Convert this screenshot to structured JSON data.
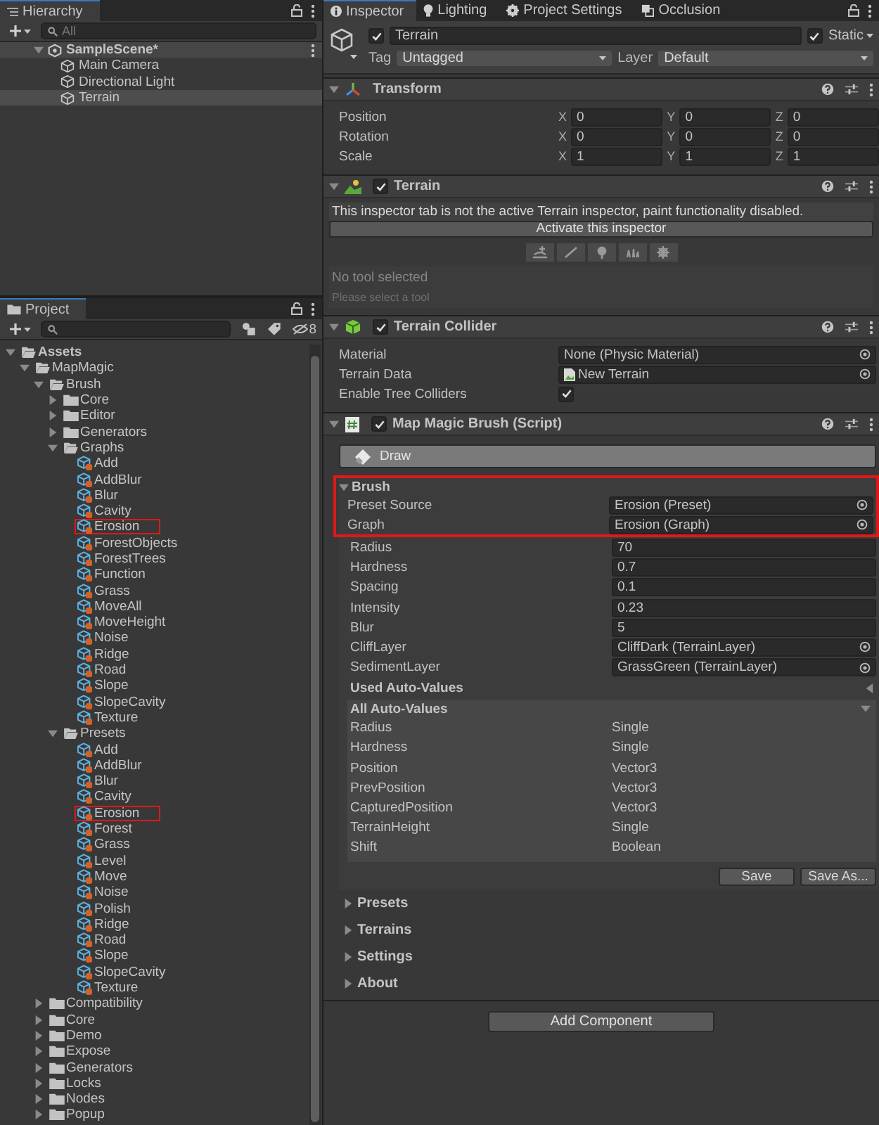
{
  "hierarchy": {
    "title": "Hierarchy",
    "search_placeholder": "All",
    "scene": {
      "name": "SampleScene*",
      "expanded": true,
      "children": [
        {
          "name": "Main Camera",
          "selected": false
        },
        {
          "name": "Directional Light",
          "selected": false
        },
        {
          "name": "Terrain",
          "selected": true
        }
      ]
    }
  },
  "project": {
    "title": "Project",
    "hidden_count": "8",
    "tree": [
      {
        "name": "Assets",
        "kind": "folder",
        "expanded": true,
        "children": [
          {
            "name": "MapMagic",
            "kind": "folder",
            "expanded": true,
            "children": [
              {
                "name": "Brush",
                "kind": "folder",
                "expanded": true,
                "children": [
                  {
                    "name": "Core",
                    "kind": "folder",
                    "expanded": false
                  },
                  {
                    "name": "Editor",
                    "kind": "folder",
                    "expanded": false
                  },
                  {
                    "name": "Generators",
                    "kind": "folder",
                    "expanded": false
                  },
                  {
                    "name": "Graphs",
                    "kind": "folder",
                    "expanded": true,
                    "children": [
                      {
                        "name": "Add",
                        "kind": "asset"
                      },
                      {
                        "name": "AddBlur",
                        "kind": "asset"
                      },
                      {
                        "name": "Blur",
                        "kind": "asset"
                      },
                      {
                        "name": "Cavity",
                        "kind": "asset"
                      },
                      {
                        "name": "Erosion",
                        "kind": "asset",
                        "annotated": true
                      },
                      {
                        "name": "ForestObjects",
                        "kind": "asset"
                      },
                      {
                        "name": "ForestTrees",
                        "kind": "asset"
                      },
                      {
                        "name": "Function",
                        "kind": "asset"
                      },
                      {
                        "name": "Grass",
                        "kind": "asset"
                      },
                      {
                        "name": "MoveAll",
                        "kind": "asset"
                      },
                      {
                        "name": "MoveHeight",
                        "kind": "asset"
                      },
                      {
                        "name": "Noise",
                        "kind": "asset"
                      },
                      {
                        "name": "Ridge",
                        "kind": "asset"
                      },
                      {
                        "name": "Road",
                        "kind": "asset"
                      },
                      {
                        "name": "Slope",
                        "kind": "asset"
                      },
                      {
                        "name": "SlopeCavity",
                        "kind": "asset"
                      },
                      {
                        "name": "Texture",
                        "kind": "asset"
                      }
                    ]
                  },
                  {
                    "name": "Presets",
                    "kind": "folder",
                    "expanded": true,
                    "children": [
                      {
                        "name": "Add",
                        "kind": "asset"
                      },
                      {
                        "name": "AddBlur",
                        "kind": "asset"
                      },
                      {
                        "name": "Blur",
                        "kind": "asset"
                      },
                      {
                        "name": "Cavity",
                        "kind": "asset"
                      },
                      {
                        "name": "Erosion",
                        "kind": "asset",
                        "annotated": true
                      },
                      {
                        "name": "Forest",
                        "kind": "asset"
                      },
                      {
                        "name": "Grass",
                        "kind": "asset"
                      },
                      {
                        "name": "Level",
                        "kind": "asset"
                      },
                      {
                        "name": "Move",
                        "kind": "asset"
                      },
                      {
                        "name": "Noise",
                        "kind": "asset"
                      },
                      {
                        "name": "Polish",
                        "kind": "asset"
                      },
                      {
                        "name": "Ridge",
                        "kind": "asset"
                      },
                      {
                        "name": "Road",
                        "kind": "asset"
                      },
                      {
                        "name": "Slope",
                        "kind": "asset"
                      },
                      {
                        "name": "SlopeCavity",
                        "kind": "asset"
                      },
                      {
                        "name": "Texture",
                        "kind": "asset"
                      }
                    ]
                  }
                ]
              },
              {
                "name": "Compatibility",
                "kind": "folder",
                "expanded": false
              },
              {
                "name": "Core",
                "kind": "folder",
                "expanded": false
              },
              {
                "name": "Demo",
                "kind": "folder",
                "expanded": false
              },
              {
                "name": "Expose",
                "kind": "folder",
                "expanded": false
              },
              {
                "name": "Generators",
                "kind": "folder",
                "expanded": false
              },
              {
                "name": "Locks",
                "kind": "folder",
                "expanded": false
              },
              {
                "name": "Nodes",
                "kind": "folder",
                "expanded": false
              },
              {
                "name": "Popup",
                "kind": "folder",
                "expanded": false
              }
            ]
          }
        ]
      }
    ]
  },
  "inspector": {
    "tabs": [
      {
        "label": "Inspector",
        "kind": "info",
        "selected": true
      },
      {
        "label": "Lighting",
        "kind": "bulb",
        "selected": false
      },
      {
        "label": "Project Settings",
        "kind": "gear",
        "selected": false
      },
      {
        "label": "Occlusion",
        "kind": "occlusion",
        "selected": false
      }
    ],
    "object": {
      "active": true,
      "name": "Terrain",
      "static": true,
      "static_label": "Static",
      "tag_label": "Tag",
      "tag": "Untagged",
      "layer_label": "Layer",
      "layer": "Default"
    },
    "transform": {
      "title": "Transform",
      "rows": [
        {
          "label": "Position",
          "axes": [
            {
              "axis": "X",
              "value": "0"
            },
            {
              "axis": "Y",
              "value": "0"
            },
            {
              "axis": "Z",
              "value": "0"
            }
          ]
        },
        {
          "label": "Rotation",
          "axes": [
            {
              "axis": "X",
              "value": "0"
            },
            {
              "axis": "Y",
              "value": "0"
            },
            {
              "axis": "Z",
              "value": "0"
            }
          ]
        },
        {
          "label": "Scale",
          "axes": [
            {
              "axis": "X",
              "value": "1"
            },
            {
              "axis": "Y",
              "value": "1"
            },
            {
              "axis": "Z",
              "value": "1"
            }
          ]
        }
      ]
    },
    "terrain": {
      "title": "Terrain",
      "enabled": true,
      "message": "This inspector tab is not the active Terrain inspector, paint functionality disabled.",
      "activate_button": "Activate this inspector",
      "tool_status": "No tool selected",
      "tool_hint": "Please select a tool"
    },
    "terrain_collider": {
      "title": "Terrain Collider",
      "enabled": true,
      "fields": [
        {
          "label": "Material",
          "kind": "object",
          "value": "None (Physic Material)"
        },
        {
          "label": "Terrain Data",
          "kind": "asset",
          "value": "New Terrain"
        },
        {
          "label": "Enable Tree Colliders",
          "kind": "checkbox",
          "checked": true
        }
      ]
    },
    "map_magic_brush": {
      "title": "Map Magic Brush (Script)",
      "enabled": true,
      "draw_button": "Draw",
      "brush": {
        "title": "Brush",
        "expanded": true,
        "annotated": true,
        "annotated_fields": [
          {
            "label": "Preset Source",
            "kind": "object",
            "value": "Erosion (Preset)"
          },
          {
            "label": "Graph",
            "kind": "object",
            "value": "Erosion (Graph)"
          }
        ],
        "fields": [
          {
            "label": "Radius",
            "kind": "text",
            "value": "70"
          },
          {
            "label": "Hardness",
            "kind": "text",
            "value": "0.7"
          },
          {
            "label": "Spacing",
            "kind": "text",
            "value": "0.1"
          },
          {
            "label": "Intensity",
            "kind": "text",
            "value": "0.23"
          },
          {
            "label": "Blur",
            "kind": "text",
            "value": "5"
          },
          {
            "label": "CliffLayer",
            "kind": "object",
            "value": "CliffDark (TerrainLayer)"
          },
          {
            "label": "SedimentLayer",
            "kind": "object",
            "value": "GrassGreen (TerrainLayer)"
          }
        ],
        "used_auto_values": {
          "title": "Used Auto-Values",
          "expanded": false
        },
        "all_auto_values": {
          "title": "All Auto-Values",
          "expanded": true,
          "rows": [
            {
              "name": "Radius",
              "type": "Single"
            },
            {
              "name": "Hardness",
              "type": "Single"
            },
            {
              "name": "Position",
              "type": "Vector3"
            },
            {
              "name": "PrevPosition",
              "type": "Vector3"
            },
            {
              "name": "CapturedPosition",
              "type": "Vector3"
            },
            {
              "name": "TerrainHeight",
              "type": "Single"
            },
            {
              "name": "Shift",
              "type": "Boolean"
            }
          ]
        },
        "buttons": [
          "Save",
          "Save As..."
        ]
      },
      "sections": [
        {
          "title": "Presets",
          "expanded": false
        },
        {
          "title": "Terrains",
          "expanded": false
        },
        {
          "title": "Settings",
          "expanded": false
        },
        {
          "title": "About",
          "expanded": false
        }
      ]
    },
    "add_component_button": "Add Component"
  }
}
